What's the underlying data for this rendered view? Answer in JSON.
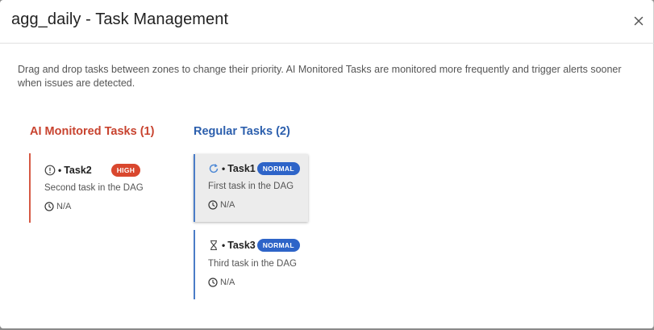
{
  "dialog": {
    "title": "agg_daily - Task Management",
    "description": "Drag and drop tasks between zones to change their priority. AI Monitored Tasks are monitored more frequently and trigger alerts sooner when issues are detected."
  },
  "zones": {
    "ai": {
      "title": "AI Monitored Tasks (1)",
      "color": "#c8432f",
      "tasks": [
        {
          "name": "Task2",
          "bullet": "•",
          "badge": "HIGH",
          "description": "Second task in the DAG",
          "time": "N/A",
          "icon": "alert-circle-icon"
        }
      ]
    },
    "regular": {
      "title": "Regular Tasks (2)",
      "color": "#2c5fad",
      "tasks": [
        {
          "name": "Task1",
          "bullet": "•",
          "badge": "NORMAL",
          "description": "First task in the DAG",
          "time": "N/A",
          "icon": "refresh-icon"
        },
        {
          "name": "Task3",
          "bullet": "•",
          "badge": "NORMAL",
          "description": "Third task in the DAG",
          "time": "N/A",
          "icon": "hourglass-icon"
        }
      ]
    }
  },
  "colors": {
    "high_badge": "#d9472e",
    "normal_badge": "#2e64c8",
    "ai_border": "#d65a45",
    "regular_border": "#4a7cc7"
  }
}
